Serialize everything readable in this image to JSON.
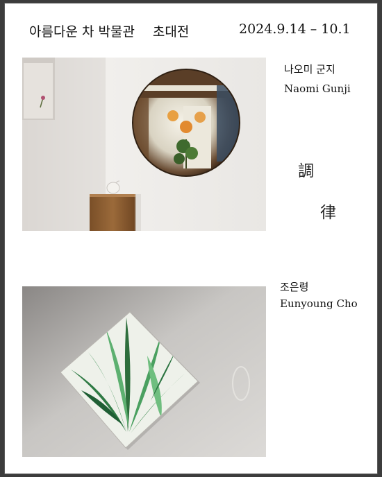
{
  "header": {
    "museum": "아름다운 차 박물관",
    "event": "초대전",
    "dates": "2024.9.14 – 10.1"
  },
  "artist1": {
    "name_ko": "나오미 군지",
    "name_en": "Naomi Gunji"
  },
  "artist2": {
    "name_ko": "조은령",
    "name_en": "Eunyoung Cho"
  },
  "theme": {
    "char1": "調",
    "char2": "律"
  },
  "colors": {
    "background": "#3c3c3c",
    "page": "#ffffff",
    "text": "#111111"
  }
}
